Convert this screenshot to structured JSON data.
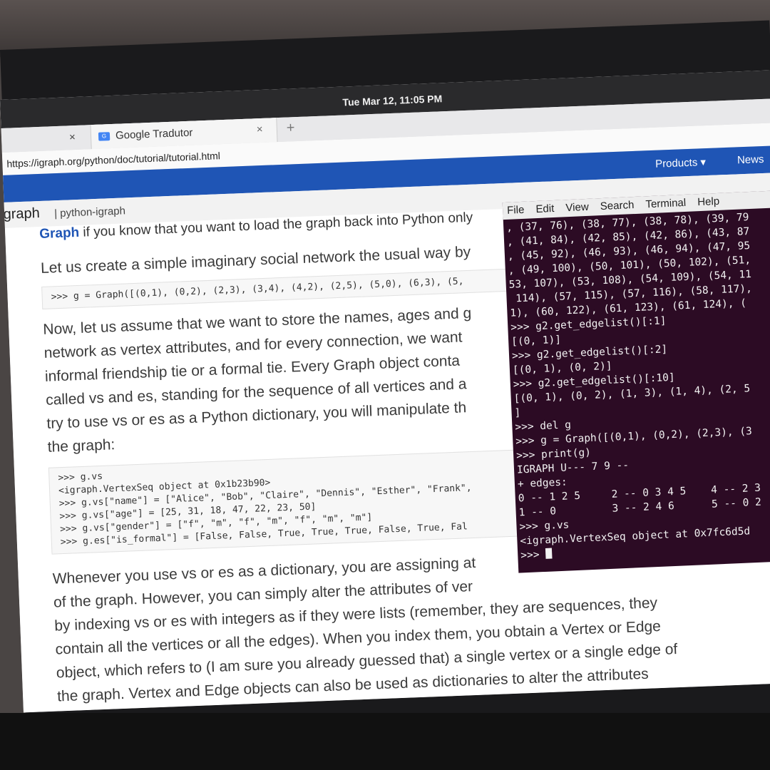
{
  "system": {
    "clock": "Tue Mar 12, 11:05 PM"
  },
  "browser": {
    "tab_left_close": "×",
    "tab_title": "Google Tradutor",
    "tab_close": "×",
    "new_tab": "+",
    "url": "https://igraph.org/python/doc/tutorial/tutorial.html"
  },
  "site_nav": {
    "products": "Products ▾",
    "news": "News"
  },
  "breadcrumb": {
    "brand": "igraph",
    "section": "| python-igraph"
  },
  "doc": {
    "heading_bold": "Graph",
    "heading_rest": " if you know that you want to load the graph back into Python only",
    "para1": "Let us create a simple imaginary social network the usual way by",
    "code1": ">>> g = Graph([(0,1), (0,2), (2,3), (3,4), (4,2), (2,5), (5,0), (6,3), (5,",
    "para2_lines": [
      "Now, let us assume that we want to store the names, ages and g",
      "network as vertex attributes, and for every connection, we want",
      "informal friendship tie or a formal tie. Every Graph object conta",
      "called vs and es, standing for the sequence of all vertices and a",
      "try to use vs or es as a Python dictionary, you will manipulate th",
      "the graph:"
    ],
    "code2_lines": [
      ">>> g.vs",
      "<igraph.VertexSeq object at 0x1b23b90>",
      ">>> g.vs[\"name\"] = [\"Alice\", \"Bob\", \"Claire\", \"Dennis\", \"Esther\", \"Frank\",",
      ">>> g.vs[\"age\"] = [25, 31, 18, 47, 22, 23, 50]",
      ">>> g.vs[\"gender\"] = [\"f\", \"m\", \"f\", \"m\", \"f\", \"m\", \"m\"]",
      ">>> g.es[\"is_formal\"] = [False, False, True, True, True, False, True, Fal"
    ],
    "para3_lines": [
      "Whenever you use vs or es as a dictionary, you are assigning at",
      "of the graph. However, you can simply alter the attributes of ver",
      "by indexing vs or es with integers as if they were lists (remember, they are sequences, they",
      "contain all the vertices or all the edges). When you index them, you obtain a Vertex or Edge",
      "object, which refers to (I am sure you already guessed that) a single vertex or a single edge of",
      "the graph. Vertex and Edge objects can also be used as dictionaries to alter the attributes"
    ]
  },
  "terminal": {
    "menu": [
      "File",
      "Edit",
      "View",
      "Search",
      "Terminal",
      "Help"
    ],
    "lines": [
      ", (37, 76), (38, 77), (38, 78), (39, 79",
      ", (41, 84), (42, 85), (42, 86), (43, 87",
      ", (45, 92), (46, 93), (46, 94), (47, 95",
      ", (49, 100), (50, 101), (50, 102), (51,",
      "53, 107), (53, 108), (54, 109), (54, 11",
      " 114), (57, 115), (57, 116), (58, 117),",
      "1), (60, 122), (61, 123), (61, 124), (",
      ">>> g2.get_edgelist()[:1]",
      "[(0, 1)]",
      ">>> g2.get_edgelist()[:2]",
      "[(0, 1), (0, 2)]",
      ">>> g2.get_edgelist()[:10]",
      "[(0, 1), (0, 2), (1, 3), (1, 4), (2, 5",
      "]",
      ">>> del g",
      ">>> g = Graph([(0,1), (0,2), (2,3), (3",
      ">>> print(g)",
      "IGRAPH U--- 7 9 --",
      "+ edges:",
      "0 -- 1 2 5     2 -- 0 3 4 5    4 -- 2 3",
      "1 -- 0         3 -- 2 4 6      5 -- 0 2",
      ">>> g.vs",
      "<igraph.VertexSeq object at 0x7fc6d5d"
    ],
    "prompt": ">>> "
  }
}
